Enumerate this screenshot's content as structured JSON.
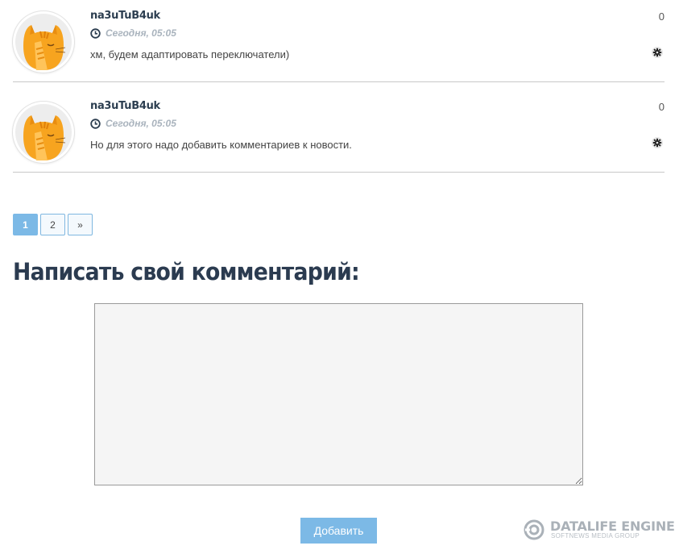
{
  "comments": [
    {
      "author": "na3uTuB4uk",
      "date": "Сегодня, 05:05",
      "text": "хм, будем адаптировать переключатели)",
      "rating": "0"
    },
    {
      "author": "na3uTuB4uk",
      "date": "Сегодня, 05:05",
      "text": "Но для этого надо добавить комментариев к новости.",
      "rating": "0"
    }
  ],
  "pagination": {
    "pages": [
      "1",
      "2"
    ],
    "next": "»",
    "active_page": "1"
  },
  "form": {
    "heading": "Написать свой комментарий:",
    "submit_label": "Добавить"
  },
  "footer_logo": {
    "brand": "DATALIFE ENGINE",
    "tagline": "SOFTNEWS MEDIA GROUP"
  },
  "colors": {
    "accent": "#7cb9e6",
    "heading": "#2b3b50",
    "date_text": "#a9b3bd",
    "avatar_cat": "#f7a41f"
  },
  "icons": [
    "cat-avatar-icon",
    "clock-icon",
    "gear-icon",
    "datalife-logo-icon"
  ]
}
